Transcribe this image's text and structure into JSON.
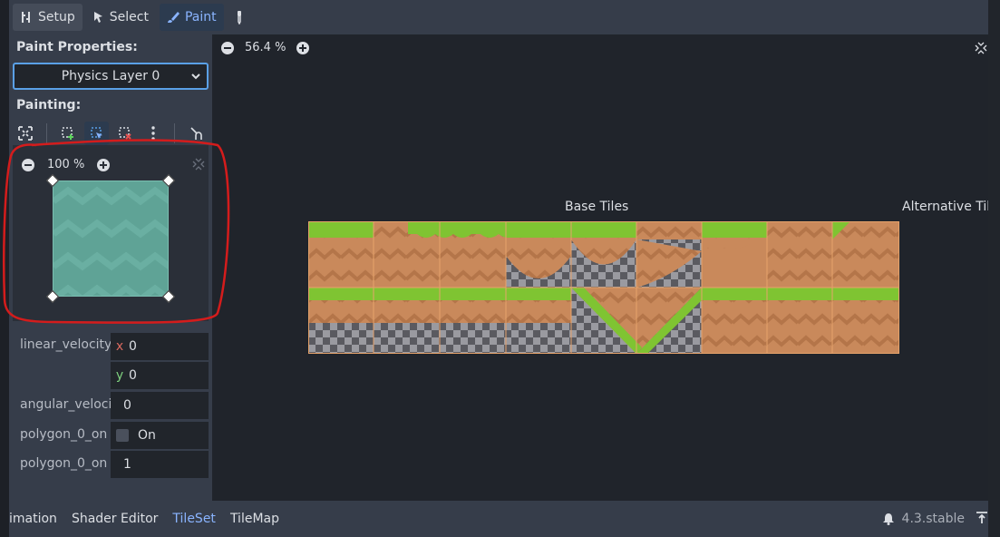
{
  "toolbar": {
    "setup_label": "Setup",
    "select_label": "Select",
    "paint_label": "Paint"
  },
  "left": {
    "paint_properties_heading": "Paint Properties:",
    "layer_select_value": "Physics Layer 0",
    "painting_heading": "Painting:",
    "preview_zoom": "100 %",
    "properties": {
      "linear_velocity_label": "linear_velocity",
      "linear_velocity_x_axis": "x",
      "linear_velocity_x": "0",
      "linear_velocity_y_axis": "y",
      "linear_velocity_y": "0",
      "angular_velocity_label": "angular_veloci",
      "angular_velocity": "0",
      "polygon_one_way_label": "polygon_0_on",
      "polygon_one_way_value": "On",
      "polygon_margin_label": "polygon_0_on",
      "polygon_margin_value": "1"
    }
  },
  "view": {
    "zoom": "56.4 %",
    "base_tiles_label": "Base Tiles",
    "alternative_tiles_label": "Alternative Tile"
  },
  "bottombar": {
    "tabs": [
      "imation",
      "Shader Editor",
      "TileSet",
      "TileMap"
    ],
    "active_tab": "TileSet",
    "version": "4.3.stable"
  },
  "colors": {
    "accent": "#8ab4ff",
    "annotation_red": "#d41c1c",
    "grass": "#7fc432",
    "dirt": "#c9895b",
    "checker_dark": "#5a5a60",
    "checker_light": "#9a9aa0"
  }
}
